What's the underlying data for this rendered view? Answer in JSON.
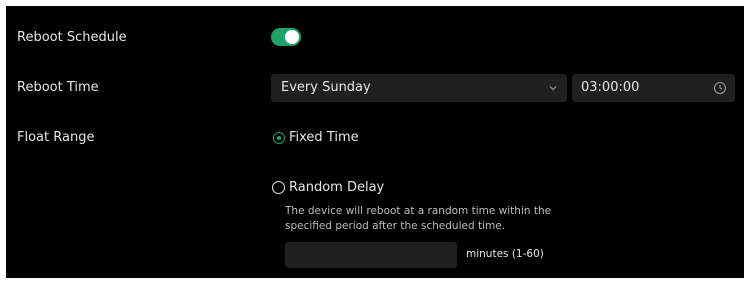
{
  "reboot_schedule": {
    "label": "Reboot Schedule",
    "enabled": true,
    "accent_color": "#1ea36b"
  },
  "reboot_time": {
    "label": "Reboot Time",
    "frequency": "Every Sunday",
    "time": "03:00:00",
    "dropdown_icon": "chevron-down-icon",
    "time_icon": "clock-icon"
  },
  "float_range": {
    "label": "Float Range",
    "options": [
      {
        "label": "Fixed Time",
        "selected": true
      },
      {
        "label": "Random Delay",
        "selected": false
      }
    ],
    "description": "The device will reboot at a random time within the specified period after the scheduled time.",
    "delay_value": "",
    "delay_unit": "minutes (1-60)"
  }
}
